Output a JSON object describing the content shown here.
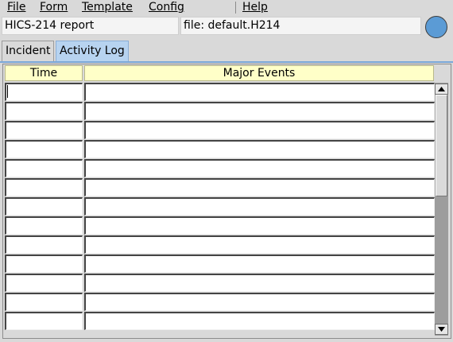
{
  "menu": {
    "file_label": "File",
    "form_label": "Form",
    "template_label": "Template",
    "config_label": "Config",
    "help_label": "Help"
  },
  "header": {
    "report_title": "HICS-214 report",
    "file_label": "file: default.H214",
    "status_light_color": "#5b9bd5"
  },
  "tabs": [
    {
      "label": "Incident",
      "active": false
    },
    {
      "label": "Activity Log",
      "active": true
    }
  ],
  "table": {
    "columns": [
      "Time",
      "Major Events"
    ],
    "rows": [
      {
        "time": "",
        "event": ""
      },
      {
        "time": "",
        "event": ""
      },
      {
        "time": "",
        "event": ""
      },
      {
        "time": "",
        "event": ""
      },
      {
        "time": "",
        "event": ""
      },
      {
        "time": "",
        "event": ""
      },
      {
        "time": "",
        "event": ""
      },
      {
        "time": "",
        "event": ""
      },
      {
        "time": "",
        "event": ""
      },
      {
        "time": "",
        "event": ""
      },
      {
        "time": "",
        "event": ""
      },
      {
        "time": "",
        "event": ""
      },
      {
        "time": "",
        "event": ""
      }
    ]
  },
  "icons": {
    "scroll_up": "triangle-up-icon",
    "scroll_down": "triangle-down-icon"
  },
  "colors": {
    "header_bg": "#ffffc8",
    "active_tab_bg": "#b7d3f0",
    "tab_rule": "#7aa7d8"
  }
}
